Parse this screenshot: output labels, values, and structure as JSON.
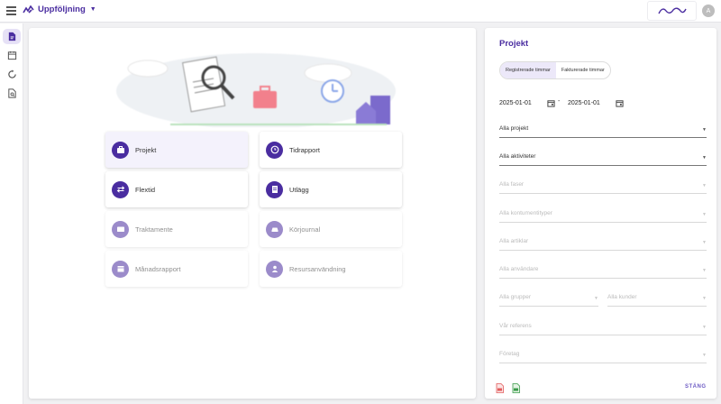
{
  "header": {
    "app_title": "Uppföljning",
    "avatar_initial": "A",
    "icons": [
      "menu-icon",
      "brand-logo-icon",
      "chevron-down-icon",
      "company-logo"
    ]
  },
  "sidebar": {
    "items": [
      {
        "name": "report-icon",
        "active": true
      },
      {
        "name": "calendar-edit-icon",
        "active": false
      },
      {
        "name": "sync-icon",
        "active": false
      },
      {
        "name": "document-search-icon",
        "active": false
      }
    ]
  },
  "tiles": [
    {
      "label": "Projekt",
      "icon": "briefcase-icon"
    },
    {
      "label": "Tidrapport",
      "icon": "clock-icon"
    },
    {
      "label": "Flextid",
      "icon": "swap-arrows-icon"
    },
    {
      "label": "Utlägg",
      "icon": "receipt-icon"
    },
    {
      "label": "Traktamente",
      "icon": "card-icon"
    },
    {
      "label": "Körjournal",
      "icon": "car-icon"
    },
    {
      "label": "Månadsrapport",
      "icon": "calendar-icon"
    },
    {
      "label": "Resursanvändning",
      "icon": "person-icon"
    }
  ],
  "panel": {
    "title": "Projekt",
    "tabs": [
      {
        "label": "Registrerade timmar",
        "selected": true
      },
      {
        "label": "Fakturerade timmar",
        "selected": false
      }
    ],
    "date_from": "2025-01-01",
    "date_separator": "-",
    "date_to": "2025-01-01",
    "filters": {
      "projekt": "Alla projekt",
      "aktiviteter": "Alla aktiviteter",
      "faser": "Alla faser",
      "kostnadstyper": "Alla kontumentityper",
      "artiklar": "Alla artiklar",
      "anvandare": "Alla användare",
      "grupper": "Alla grupper",
      "kunder": "Alla kunder",
      "referens": "Vår referens",
      "foretag": "Företag"
    },
    "close_label": "STÄNG",
    "export_icons": [
      "pdf-icon",
      "excel-icon"
    ]
  },
  "colors": {
    "accent": "#4a2da0",
    "background": "#f1f1f3",
    "active_tile": "#f4f2fc"
  }
}
